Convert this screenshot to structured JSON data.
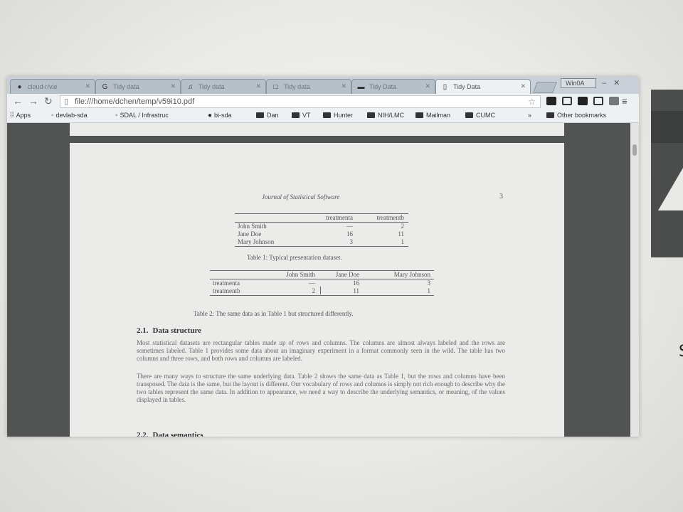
{
  "tabs": [
    {
      "label": "cloud-r/vie"
    },
    {
      "label": "Tidy data"
    },
    {
      "label": "Tidy data"
    },
    {
      "label": "Tidy data"
    },
    {
      "label": "Tidy Data"
    },
    {
      "label": "Tidy Data"
    }
  ],
  "profile": {
    "label": "Win0A"
  },
  "address": {
    "url": "file:///home/dchen/temp/v59i10.pdf"
  },
  "bookmarks": {
    "apps": "Apps",
    "items": [
      "devlab-sda",
      "SDAL / Infrastruc",
      "bi-sda",
      "Dan",
      "VT",
      "Hunter",
      "NIH/LMC",
      "Mailman",
      "CUMC"
    ],
    "other": "Other bookmarks"
  },
  "document": {
    "journal": "Journal of Statistical Software",
    "page_number": "3",
    "table1": {
      "columns": [
        "",
        "treatmenta",
        "treatmentb"
      ],
      "rows": [
        [
          "John Smith",
          "—",
          "2"
        ],
        [
          "Jane Doe",
          "16",
          "11"
        ],
        [
          "Mary Johnson",
          "3",
          "1"
        ]
      ],
      "caption": "Table 1: Typical presentation dataset."
    },
    "table2": {
      "columns": [
        "",
        "John Smith",
        "Jane Doe",
        "Mary Johnson"
      ],
      "rows": [
        [
          "treatmenta",
          "—",
          "16",
          "3"
        ],
        [
          "treatmentb",
          "2",
          "11",
          "1"
        ]
      ],
      "caption": "Table 2: The same data as in Table 1 but structured differently."
    },
    "section1": {
      "number": "2.1.",
      "title": "Data structure"
    },
    "para1": "Most statistical datasets are rectangular tables made up of rows and columns. The columns are almost always labeled and the rows are sometimes labeled. Table 1 provides some data about an imaginary experiment in a format commonly seen in the wild. The table has two columns and three rows, and both rows and columns are labeled.",
    "para2": "There are many ways to structure the same underlying data. Table 2 shows the same data as Table 1, but the rows and columns have been transposed. The data is the same, but the layout is different. Our vocabulary of rows and columns is simply not rich enough to describe why the two tables represent the same data. In addition to appearance, we need a way to describe the underlying semantics, or meaning, of the values displayed in tables.",
    "section2": {
      "number": "2.2.",
      "title": "Data semantics"
    }
  },
  "side_glyph": "S"
}
